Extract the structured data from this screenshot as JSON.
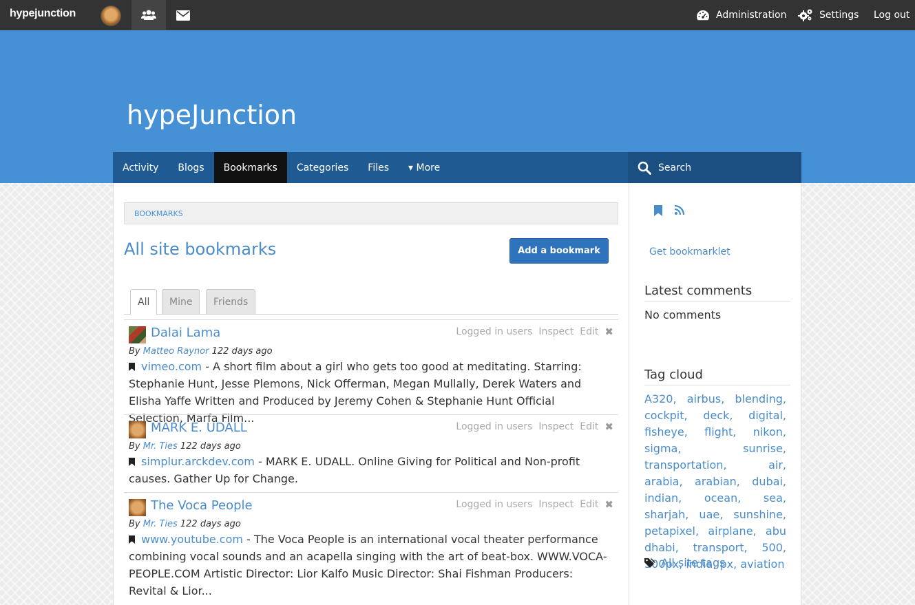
{
  "topbar": {
    "logo": "hypejunction",
    "admin_label": "Administration",
    "settings_label": "Settings",
    "logout_label": "Log out"
  },
  "site": {
    "title": "hypeJunction"
  },
  "nav": {
    "items": [
      {
        "label": "Activity"
      },
      {
        "label": "Blogs"
      },
      {
        "label": "Bookmarks"
      },
      {
        "label": "Categories"
      },
      {
        "label": "Files"
      },
      {
        "label": "▾ More"
      }
    ],
    "search_label": "Search"
  },
  "main": {
    "breadcrumb": "BOOKMARKS",
    "page_title": "All site bookmarks",
    "add_button": "Add a bookmark",
    "tabs": [
      {
        "label": "All"
      },
      {
        "label": "Mine"
      },
      {
        "label": "Friends"
      }
    ],
    "items": [
      {
        "title": "Dalai Lama",
        "access": "Logged in users",
        "inspect": "Inspect",
        "edit": "Edit",
        "by": "By",
        "author": "Matteo Raynor",
        "time": "122 days ago",
        "url": "vimeo.com",
        "description": " - A short film about a girl who gets too good at meditating. Starring: Stephanie Hunt, Jesse Plemons, Nick Offerman, Megan Mullally, Derek Waters and Elisha Yaffe Written and Produced by Jeremy Cohen & Stephanie Hunt Official Selection, Marfa Film..."
      },
      {
        "title": "MARK E. UDALL",
        "access": "Logged in users",
        "inspect": "Inspect",
        "edit": "Edit",
        "by": "By",
        "author": "Mr. Ties",
        "time": "122 days ago",
        "url": "simplur.arckdev.com",
        "description": " - MARK E. UDALL. Online Giving for Political and Non-profit causes. Gather Up for Change."
      },
      {
        "title": "The Voca People",
        "access": "Logged in users",
        "inspect": "Inspect",
        "edit": "Edit",
        "by": "By",
        "author": "Mr. Ties",
        "time": "122 days ago",
        "url": "www.youtube.com",
        "description": " - The Voca People is an international vocal theater performance combining vocal sounds and an acapella singing with the art of beat-box. WWW.VOCA-PEOPLE.COM Artistic Director: Lior Kalfo Music Director: Shai Fishman Producers: Revital & Lior..."
      }
    ]
  },
  "sidebar": {
    "bookmarklet": "Get bookmarklet",
    "latest_comments_title": "Latest comments",
    "no_comments": "No comments",
    "tag_cloud_title": "Tag cloud",
    "tags": "A320, airbus, blending, cockpit, deck, digital, fisheye, flight, nikon, sigma, sunrise, transportation, air, arabia, arabian, dubai, indian, ocean, sea, sharjah, uae, sunshine, petapixel, airplane, abu dhabi, transport, 500, 500px, india, px, aviation",
    "all_tags": "All site tags"
  },
  "colors": {
    "topbar": "#333333",
    "header_band": "#4690d6",
    "nav": "#1f5a93",
    "nav_active": "#111111",
    "link": "#4a8cca",
    "button": "#2f73bd"
  }
}
